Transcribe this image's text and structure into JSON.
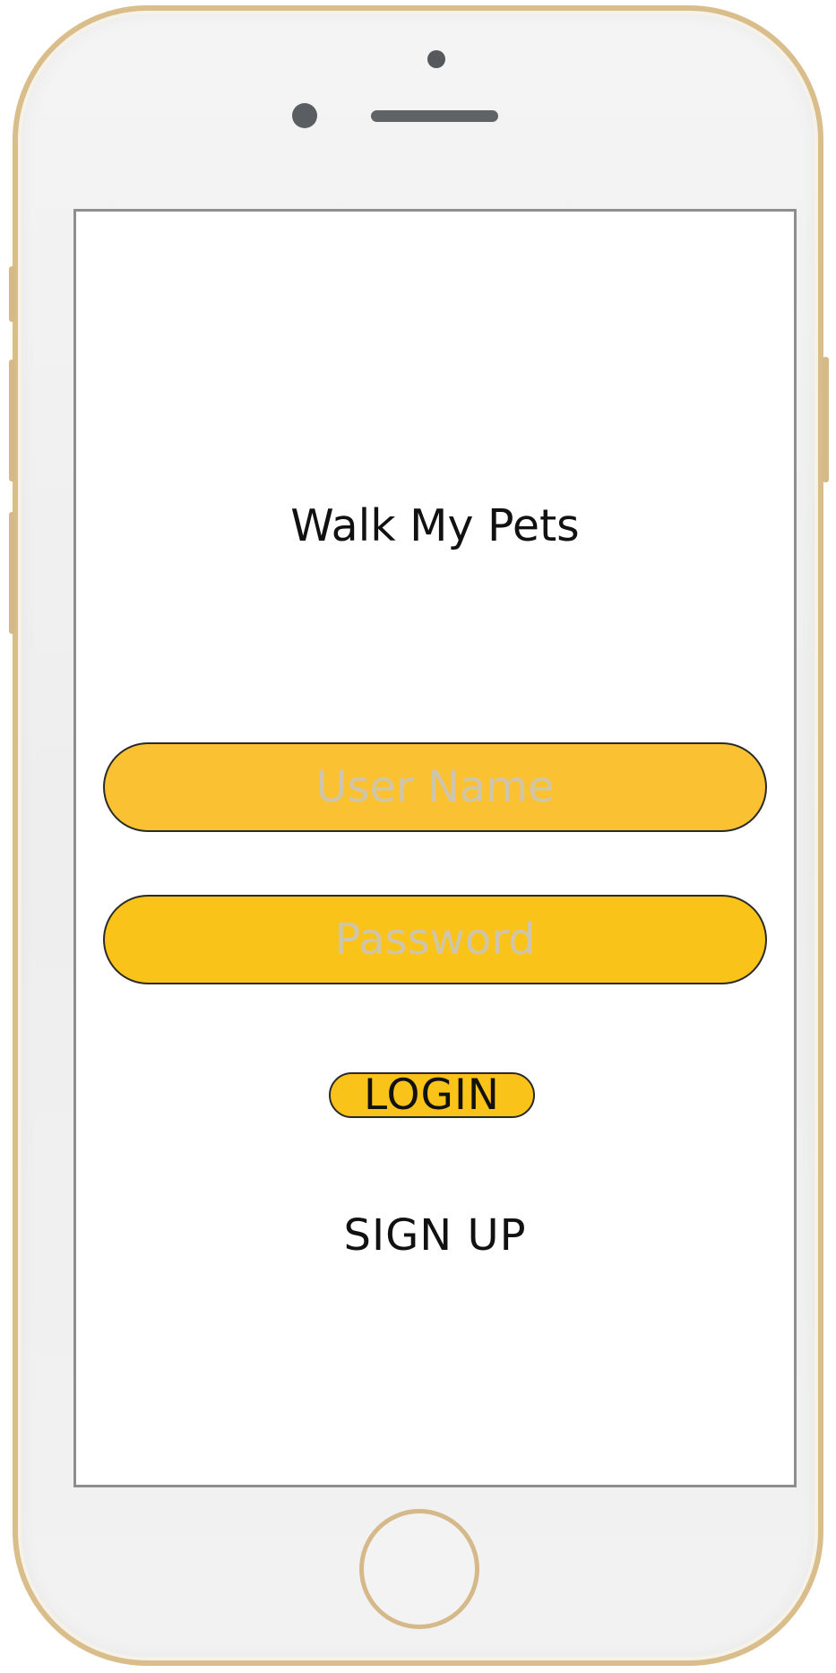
{
  "app": {
    "title": "Walk My Pets"
  },
  "login_form": {
    "username_placeholder": "User Name",
    "password_placeholder": "Password",
    "login_label": "LOGIN",
    "signup_label": "SIGN UP"
  },
  "colors": {
    "primary_yellow": "#fac319",
    "username_yellow": "#fac232",
    "text_dark": "#111111",
    "placeholder_text": "#cfc5aa",
    "phone_gold": "#d6b98a"
  }
}
